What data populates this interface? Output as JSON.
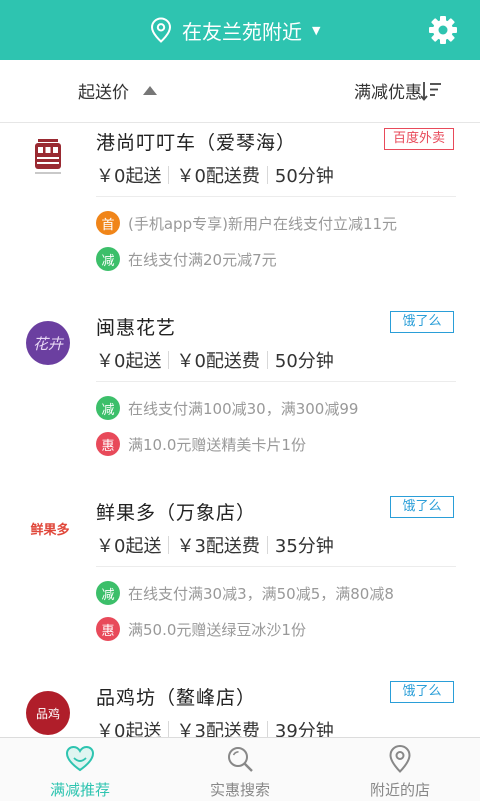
{
  "header": {
    "location": "在友兰苑附近",
    "caret": "▼",
    "settings_icon": "gear-icon",
    "location_icon": "map-pin-icon",
    "bg_color": "#2ec4b0"
  },
  "sortbar": {
    "left_label": "起送价",
    "right_label": "满减优惠",
    "sort_icon": "sort-descending-icon"
  },
  "shops": [
    {
      "name": "港尚叮叮车（爱琴海）",
      "source": "百度外卖",
      "source_color": "#e84a5a",
      "logo_icon": "tram-logo-icon",
      "min_order": "￥0起送",
      "delivery_fee": "￥0配送费",
      "delivery_time": "50分钟",
      "promos": [
        {
          "badge": "首",
          "color": "#f08519",
          "text": "(手机app专享)新用户在线支付立减11元"
        },
        {
          "badge": "减",
          "color": "#3cbf6a",
          "text": "在线支付满20元减7元"
        }
      ]
    },
    {
      "name": "闽惠花艺",
      "source": "饿了么",
      "source_color": "#2a9ed8",
      "logo_icon": "flower-logo-icon",
      "logo_text": "花卉",
      "min_order": "￥0起送",
      "delivery_fee": "￥0配送费",
      "delivery_time": "50分钟",
      "promos": [
        {
          "badge": "减",
          "color": "#3cbf6a",
          "text": "在线支付满100减30，满300减99"
        },
        {
          "badge": "惠",
          "color": "#e84a5a",
          "text": "满10.0元赠送精美卡片1份"
        }
      ]
    },
    {
      "name": "鲜果多（万象店）",
      "source": "饿了么",
      "source_color": "#2a9ed8",
      "logo_icon": "fruit-logo-icon",
      "logo_text": "鲜果多",
      "min_order": "￥0起送",
      "delivery_fee": "￥3配送费",
      "delivery_time": "35分钟",
      "promos": [
        {
          "badge": "减",
          "color": "#3cbf6a",
          "text": "在线支付满30减3，满50减5，满80减8"
        },
        {
          "badge": "惠",
          "color": "#e84a5a",
          "text": "满50.0元赠送绿豆冰沙1份"
        }
      ]
    },
    {
      "name": "品鸡坊（鳌峰店）",
      "source": "饿了么",
      "source_color": "#2a9ed8",
      "logo_icon": "chicken-logo-icon",
      "logo_text": "品鸡",
      "min_order": "￥0起送",
      "delivery_fee": "￥3配送费",
      "delivery_time": "39分钟",
      "promos": []
    }
  ],
  "bottom_nav": [
    {
      "label": "满减推荐",
      "icon": "heart-icon",
      "active": true
    },
    {
      "label": "实惠搜索",
      "icon": "search-icon",
      "active": false
    },
    {
      "label": "附近的店",
      "icon": "location-pin-icon",
      "active": false
    }
  ],
  "accent_color": "#2ec4b0"
}
